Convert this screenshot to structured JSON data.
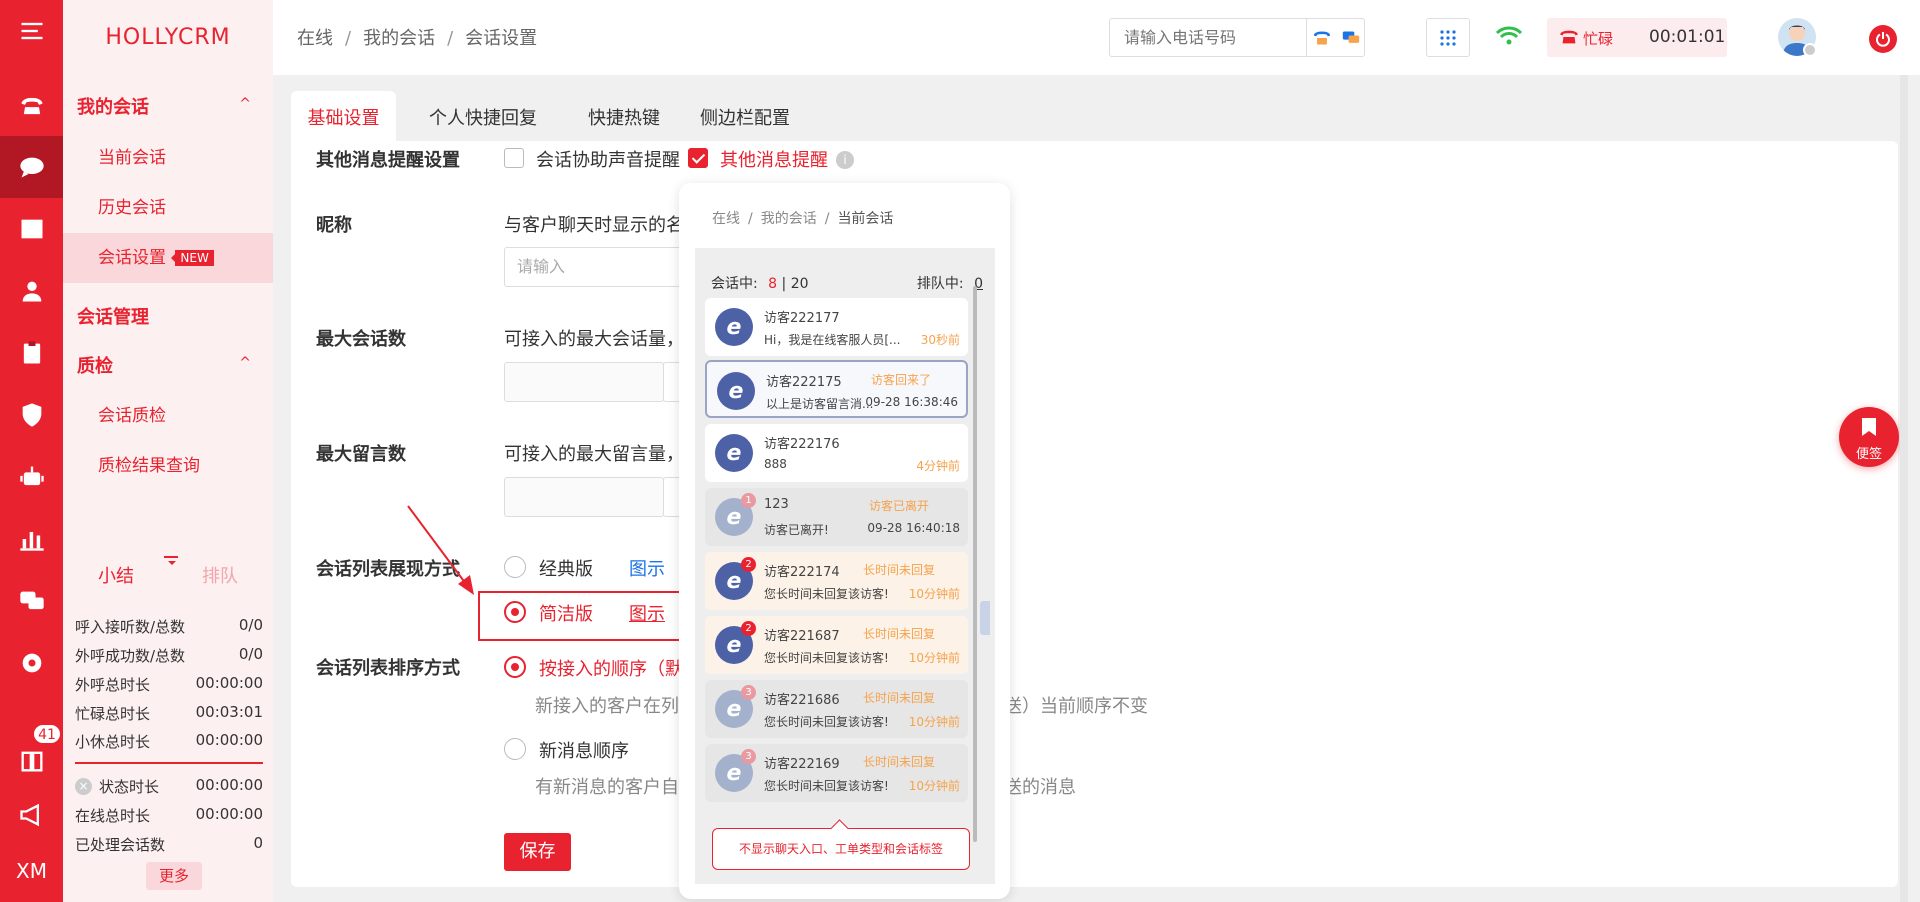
{
  "app": {
    "logo": "HOLLYCRM"
  },
  "rail": {
    "badge": "41",
    "bottom": "XM"
  },
  "sidebar": {
    "groups": [
      {
        "label": "我的会话",
        "caret": "^"
      },
      {
        "label": "会话管理"
      },
      {
        "label": "质检",
        "caret": "^"
      }
    ],
    "items": [
      {
        "label": "当前会话"
      },
      {
        "label": "历史会话"
      },
      {
        "label": "会话设置",
        "badge": "NEW"
      },
      {
        "label": "会话质检"
      },
      {
        "label": "质检结果查询"
      }
    ]
  },
  "stats": {
    "tab_summary": "小结",
    "tab_queue": "排队",
    "rows": [
      {
        "label": "呼入接听数/总数",
        "value": "0/0"
      },
      {
        "label": "外呼成功数/总数",
        "value": "0/0"
      },
      {
        "label": "外呼总时长",
        "value": "00:00:00"
      },
      {
        "label": "忙碌总时长",
        "value": "00:03:01"
      },
      {
        "label": "小休总时长",
        "value": "00:00:00"
      }
    ],
    "rows2": [
      {
        "label": "状态时长",
        "value": "00:00:00"
      },
      {
        "label": "在线总时长",
        "value": "00:00:00"
      },
      {
        "label": "已处理会话数",
        "value": "0"
      }
    ],
    "more": "更多"
  },
  "header": {
    "breadcrumb": [
      "在线",
      "我的会话",
      "会话设置"
    ],
    "phone_placeholder": "请输入电话号码",
    "status": "忙碌",
    "timer": "00:01:01"
  },
  "tabs": [
    "基础设置",
    "个人快捷回复",
    "快捷热键",
    "侧边栏配置"
  ],
  "form": {
    "reminder": {
      "label": "其他消息提醒设置",
      "opt1": "会话协助声音提醒",
      "opt2": "其他消息提醒"
    },
    "nickname": {
      "label": "昵称",
      "hint": "与客户聊天时显示的名",
      "placeholder": "请输入"
    },
    "max_sessions": {
      "label": "最大会话数",
      "hint": "可接入的最大会话量，"
    },
    "max_messages": {
      "label": "最大留言数",
      "hint": "可接入的最大留言量，"
    },
    "list_style": {
      "label": "会话列表展现方式",
      "opt_classic": "经典版",
      "opt_simple": "简洁版",
      "link": "图示"
    },
    "list_order": {
      "label": "会话列表排序方式",
      "opt1": "按接入的顺序（默",
      "opt1_desc_a": "新接入的客户在列表",
      "opt1_desc_b": "送）当前顺序不变",
      "opt2": "新消息顺序",
      "opt2_desc_a": "有新消息的客户自动",
      "opt2_desc_b": "送的消息"
    },
    "save": "保存"
  },
  "preview": {
    "breadcrumb": [
      "在线",
      "我的会话",
      "当前会话"
    ],
    "in_session_label": "会话中:",
    "in_session_count": "8",
    "in_session_total": "20",
    "queue_label": "排队中:",
    "queue_count": "0",
    "cards": [
      {
        "name": "访客222177",
        "tag": "",
        "msg": "Hi，我是在线客服人员[...",
        "time": "30秒前",
        "style": "normal",
        "badge": ""
      },
      {
        "name": "访客222175",
        "tag": "访客回来了",
        "msg": "以上是访客留言消...",
        "time": "09-28 16:38:46",
        "style": "sel",
        "badge": ""
      },
      {
        "name": "访客222176",
        "tag": "",
        "msg": "888",
        "time": "4分钟前",
        "style": "normal",
        "badge": ""
      },
      {
        "name": "123",
        "tag": "访客已离开",
        "msg": "访客已离开!",
        "time": "09-28 16:40:18",
        "style": "gray",
        "badge": "1"
      },
      {
        "name": "访客222174",
        "tag": "长时间未回复",
        "msg": "您长时间未回复该访客!",
        "time": "10分钟前",
        "style": "warn",
        "badge": "2"
      },
      {
        "name": "访客221687",
        "tag": "长时间未回复",
        "msg": "您长时间未回复该访客!",
        "time": "10分钟前",
        "style": "warn",
        "badge": "2"
      },
      {
        "name": "访客221686",
        "tag": "长时间未回复",
        "msg": "您长时间未回复该访客!",
        "time": "10分钟前",
        "style": "gray",
        "badge": "3"
      },
      {
        "name": "访客222169",
        "tag": "长时间未回复",
        "msg": "您长时间未回复该访客!",
        "time": "10分钟前",
        "style": "gray",
        "badge": "3"
      }
    ],
    "note": "不显示聊天入口、工单类型和会话标签"
  },
  "float_note": "便签",
  "colors": {
    "brand": "#e8232f",
    "link": "#1a73e8",
    "warn": "#f5a34c"
  }
}
